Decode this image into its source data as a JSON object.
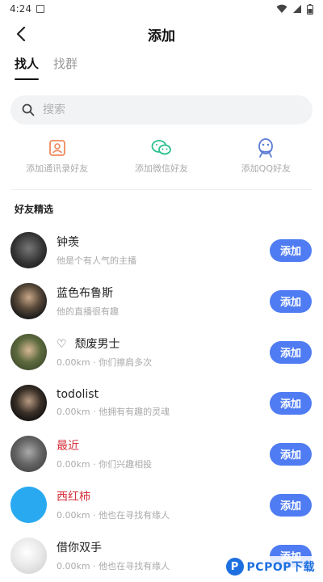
{
  "status_bar": {
    "time": "4:24"
  },
  "header": {
    "title": "添加"
  },
  "tabs": [
    {
      "label": "找人",
      "active": true
    },
    {
      "label": "找群",
      "active": false
    }
  ],
  "search": {
    "placeholder": "搜索"
  },
  "quick_actions": [
    {
      "label": "添加通讯录好友",
      "icon": "contacts-icon",
      "color": "#f08a5d"
    },
    {
      "label": "添加微信好友",
      "icon": "wechat-icon",
      "color": "#2bbf8e"
    },
    {
      "label": "添加QQ好友",
      "icon": "qq-icon",
      "color": "#5b7bd5"
    }
  ],
  "section_title": "好友精选",
  "friends": [
    {
      "name": "钟羡",
      "subtitle": "他是个有人气的主播",
      "button": "添加",
      "name_color": "normal",
      "avatar_color": "#333333"
    },
    {
      "name": "蓝色布鲁斯",
      "subtitle": "他的直播很有趣",
      "button": "添加",
      "name_color": "normal",
      "avatar_color": "#2a2a2a"
    },
    {
      "name": "颓废男士",
      "subtitle": "0.00km · 你们擦肩多次",
      "button": "添加",
      "name_color": "normal",
      "avatar_color": "#4a5a3a",
      "prefix": "♡"
    },
    {
      "name": "todolist",
      "subtitle": "0.00km · 他拥有有趣的灵魂",
      "button": "添加",
      "name_color": "normal",
      "avatar_color": "#1a1a1a"
    },
    {
      "name": "最近",
      "subtitle": "0.00km · 你们兴趣相投",
      "button": "添加",
      "name_color": "red",
      "avatar_color": "#555555"
    },
    {
      "name": "西红柿",
      "subtitle": "0.00km · 他也在寻找有缘人",
      "button": "添加",
      "name_color": "red",
      "avatar_color": "#29a9f0"
    },
    {
      "name": "借你双手",
      "subtitle": "0.00km · 他也在寻找有缘人",
      "button": "添加",
      "name_color": "normal",
      "avatar_color": "#e8e8e8"
    }
  ],
  "colors": {
    "accent": "#4f7cf3",
    "red_name": "#d6303c"
  },
  "watermark": {
    "text": "PCPOP下载",
    "logo": "P"
  }
}
